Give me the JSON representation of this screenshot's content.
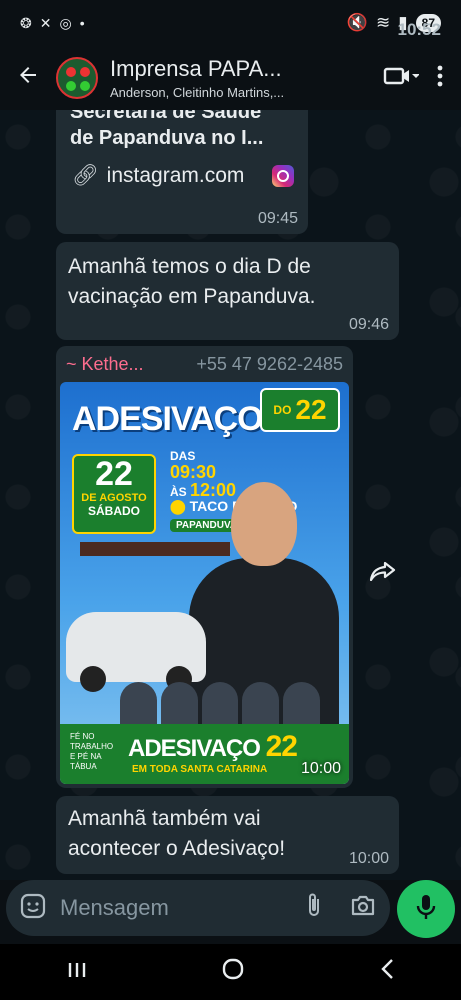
{
  "status": {
    "time": "10:52",
    "battery": "87"
  },
  "header": {
    "title": "Imprensa PAPA...",
    "subtitle": "Anderson, Cleitinho Martins,..."
  },
  "messages": {
    "m1": {
      "preview_line1": "Secretaria de Saúde",
      "preview_line2": "de Papanduva no I...",
      "link": "instagram.com",
      "time": "09:45"
    },
    "m2": {
      "text": "Amanhã temos o dia D de vacinação em Papanduva.",
      "time": "09:46"
    },
    "m3": {
      "sender": "~ Kethe...",
      "phone": "+55 47 9262-2485",
      "time": "10:00",
      "poster": {
        "title": "ADESIVAÇO",
        "do": "DO",
        "number": "22",
        "day": "22",
        "month": "DE AGOSTO",
        "weekday": "SÁBADO",
        "das": "DAS",
        "start": "09:30",
        "as": "ÀS",
        "end": "12:00",
        "place": "TACO DE OURO",
        "city": "PAPANDUVA/SC",
        "footer_title": "ADESIVAÇO",
        "footer_number": "22",
        "footer_sub": "EM TODA SANTA CATARINA",
        "footer_side": "FÉ NO TRABALHO E PÉ NA TÁBUA"
      }
    },
    "m4": {
      "text": "Amanhã também vai acontecer o Adesivaço!",
      "time": "10:00"
    }
  },
  "composer": {
    "placeholder": "Mensagem"
  }
}
